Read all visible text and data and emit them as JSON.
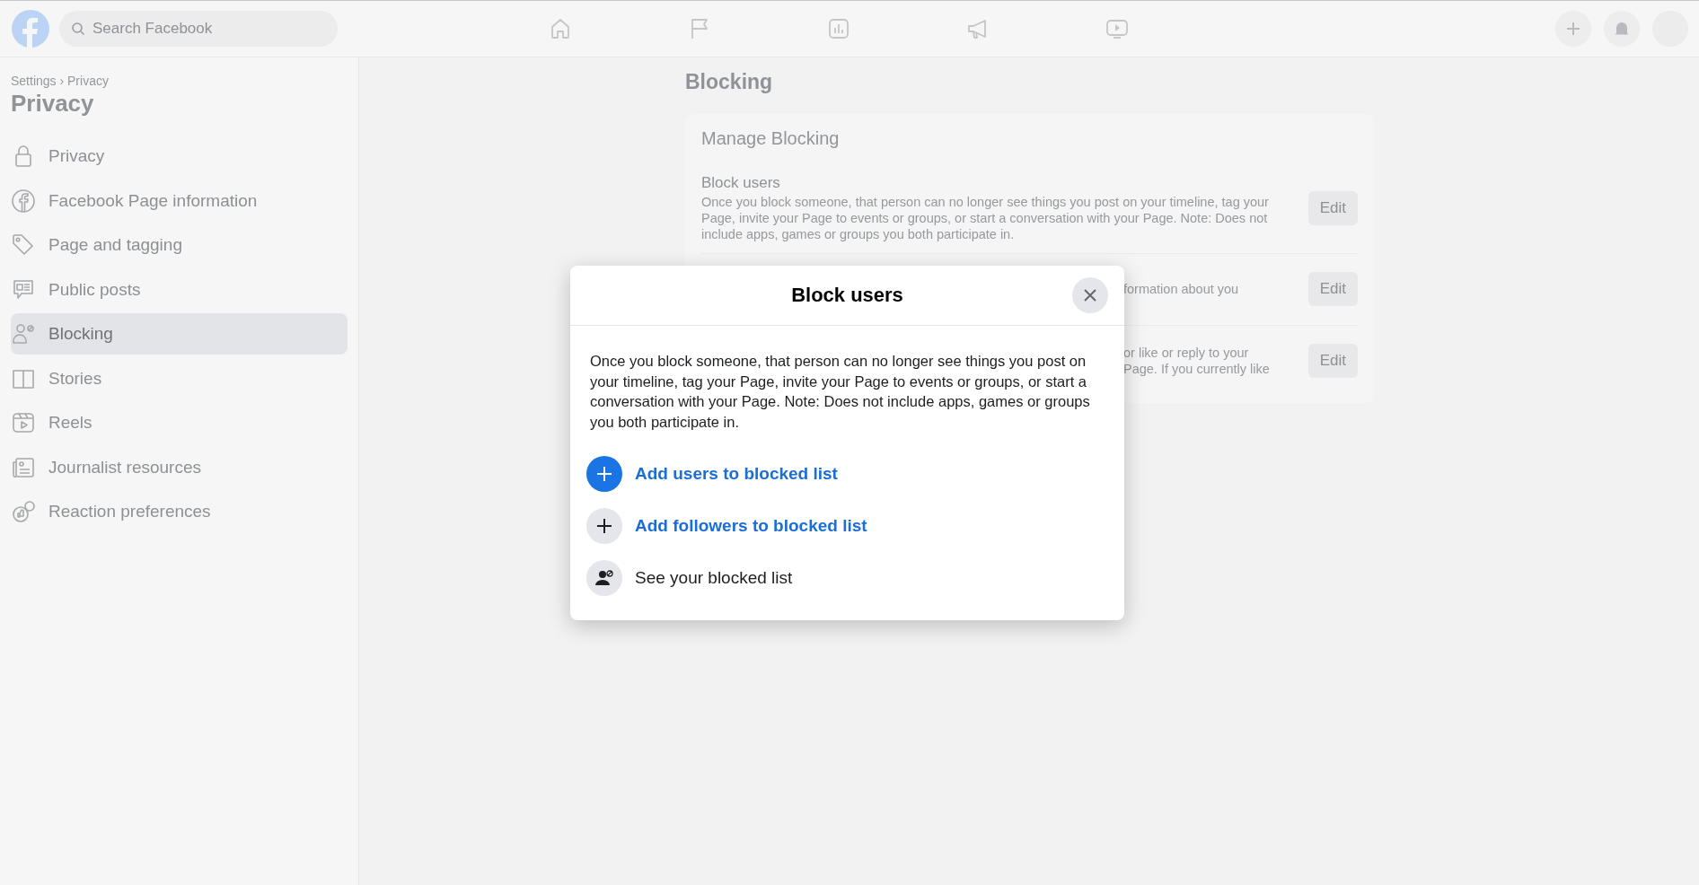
{
  "top_bar": {
    "search": {
      "placeholder": "Search Facebook"
    }
  },
  "sidebar": {
    "breadcrumb": "Settings › Privacy",
    "title": "Privacy",
    "items": [
      {
        "label": "Privacy",
        "selected": false
      },
      {
        "label": "Facebook Page information",
        "selected": false
      },
      {
        "label": "Page and tagging",
        "selected": false
      },
      {
        "label": "Public posts",
        "selected": false
      },
      {
        "label": "Blocking",
        "selected": true
      },
      {
        "label": "Stories",
        "selected": false
      },
      {
        "label": "Reels",
        "selected": false
      },
      {
        "label": "Journalist resources",
        "selected": false
      },
      {
        "label": "Reaction preferences",
        "selected": false
      }
    ]
  },
  "main": {
    "title": "Blocking",
    "card": {
      "title": "Manage Blocking",
      "rows": [
        {
          "title": "Block users",
          "lines": [
            "Once you block someone, that person can no longer see things you post on your timeline, tag your",
            "Page, invite your Page to events or groups, or start a conversation with your Page. Note: Does not",
            "include apps, games or groups you both participate in."
          ],
          "button": "Edit"
        },
        {
          "lines": [
            "formation about you"
          ],
          "button": "Edit"
        },
        {
          "lines": [
            "or like or reply to your",
            "Page. If you currently like"
          ],
          "button": "Edit"
        }
      ]
    }
  },
  "dialog": {
    "title": "Block users",
    "description": "Once you block someone, that person can no longer see things you post on your timeline, tag your Page, invite your Page to events or groups, or start a conversation with your Page. Note: Does not include apps, games or groups you both participate in.",
    "actions": [
      {
        "label": "Add users to blocked list",
        "kind": "add-primary"
      },
      {
        "label": "Add followers to blocked list",
        "kind": "add"
      },
      {
        "label": "See your blocked list",
        "kind": "list"
      }
    ]
  }
}
